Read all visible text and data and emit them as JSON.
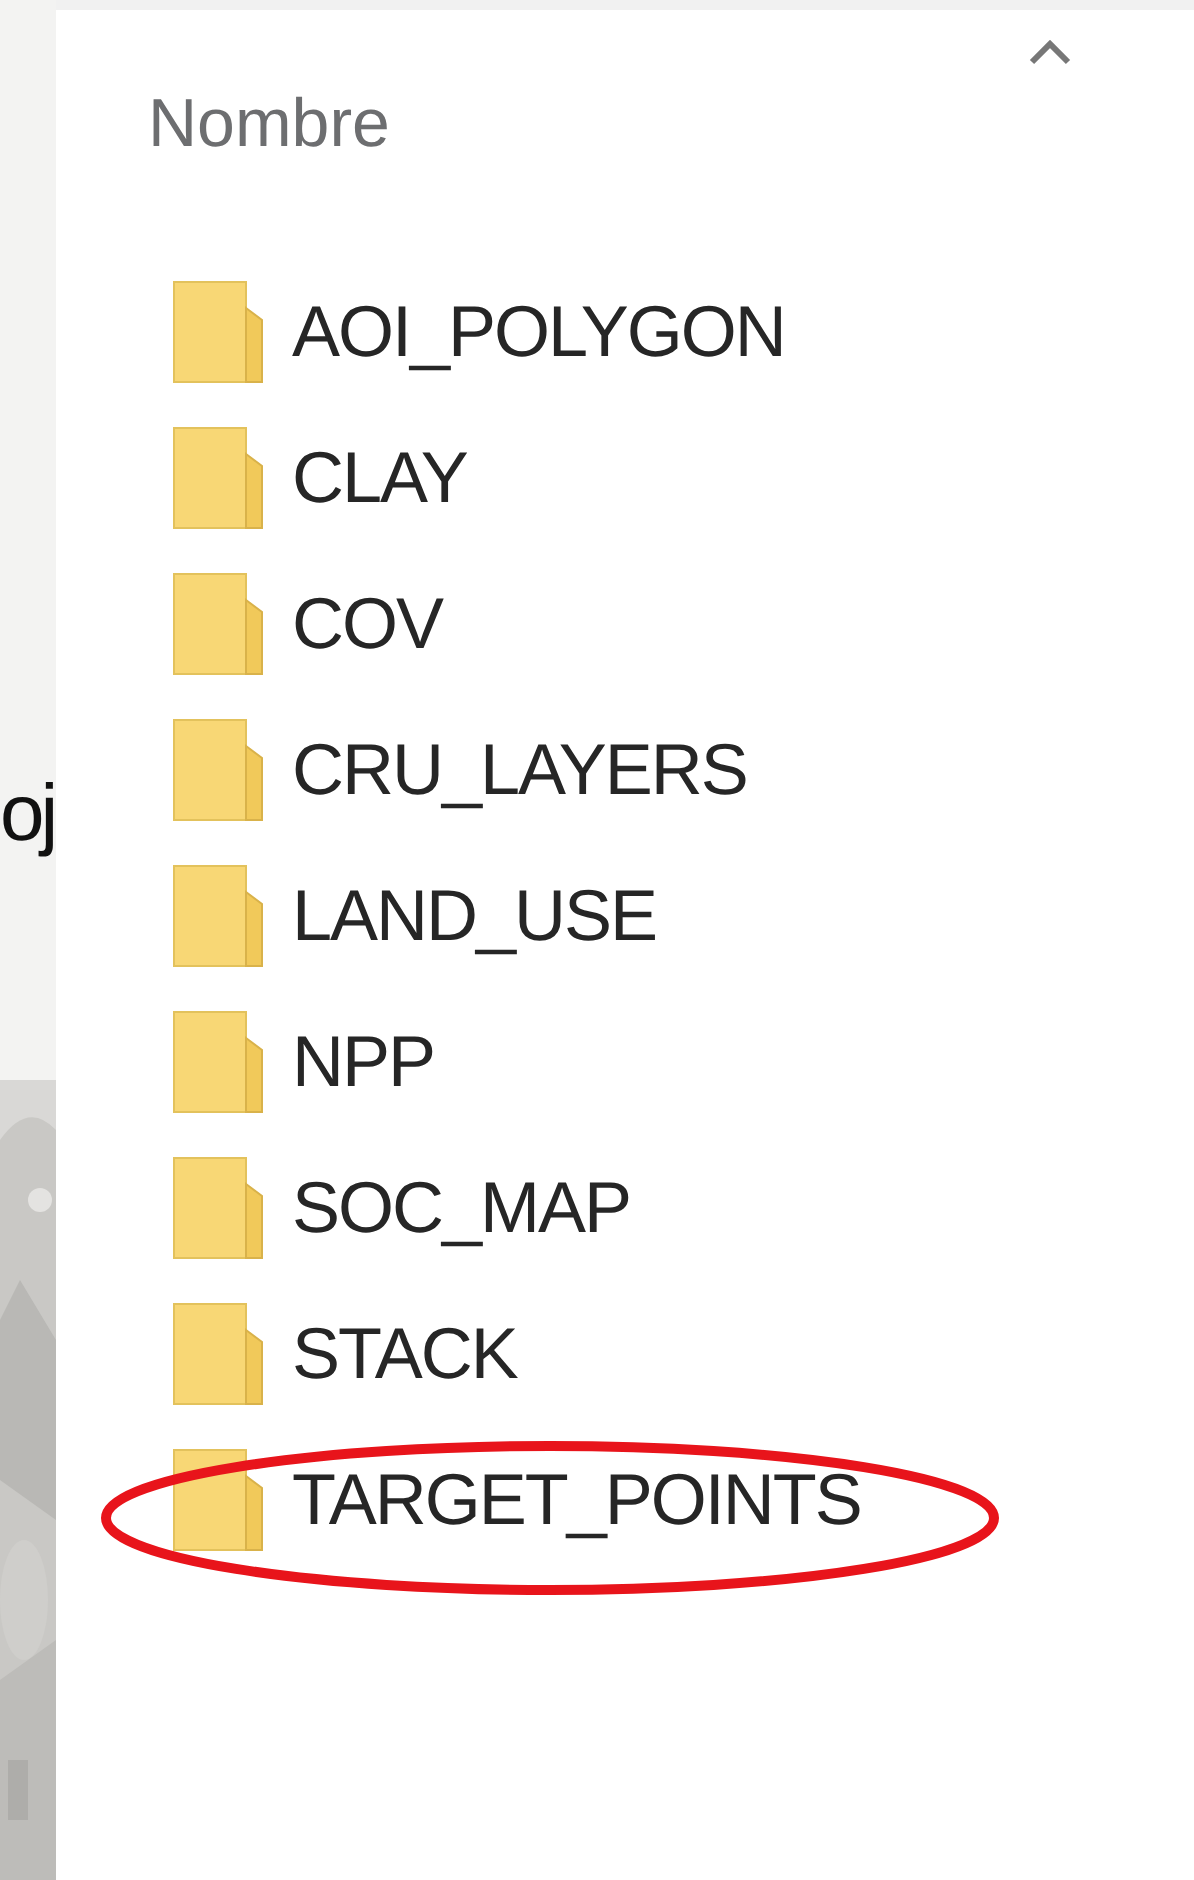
{
  "slide": {
    "text": "oj"
  },
  "explorer": {
    "column_header": "Nombre",
    "sorted_ascending": true,
    "items": [
      {
        "name": "AOI_POLYGON",
        "circled": false
      },
      {
        "name": "CLAY",
        "circled": false
      },
      {
        "name": "COV",
        "circled": false
      },
      {
        "name": "CRU_LAYERS",
        "circled": false
      },
      {
        "name": "LAND_USE",
        "circled": false
      },
      {
        "name": "NPP",
        "circled": false
      },
      {
        "name": "SOC_MAP",
        "circled": false
      },
      {
        "name": "STACK",
        "circled": false
      },
      {
        "name": "TARGET_POINTS",
        "circled": true
      }
    ]
  }
}
